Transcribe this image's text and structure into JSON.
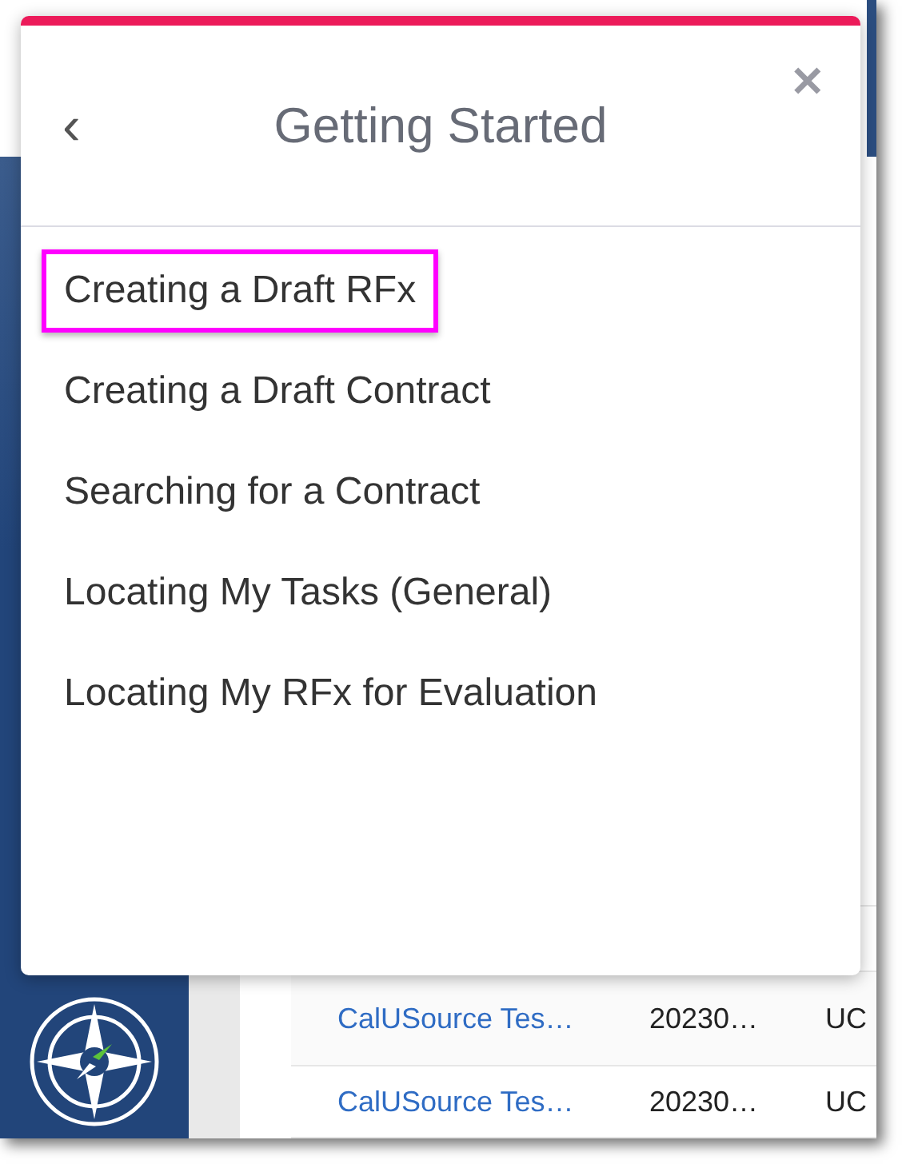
{
  "dialog": {
    "title": "Getting Started",
    "back_label": "‹",
    "close_label": "✕",
    "items": [
      {
        "label": "Creating a Draft RFx",
        "highlighted": true
      },
      {
        "label": "Creating a Draft Contract",
        "highlighted": false
      },
      {
        "label": "Searching for a Contract",
        "highlighted": false
      },
      {
        "label": "Locating My Tasks (General)",
        "highlighted": false
      },
      {
        "label": "Locating My RFx for Evaluation",
        "highlighted": false
      }
    ]
  },
  "background_table": {
    "rows": [
      {
        "name": "CalUSource Tes…",
        "date": "20230…",
        "column_3": "UC"
      },
      {
        "name": "CalUSource Tes…",
        "date": "20230…",
        "column_3": "UC"
      }
    ]
  }
}
